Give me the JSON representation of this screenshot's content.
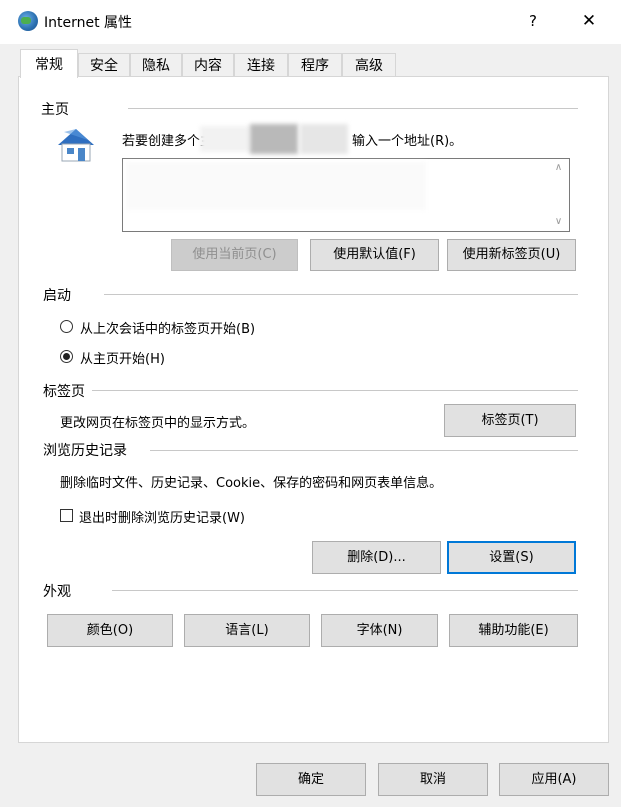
{
  "window": {
    "title": "Internet 属性",
    "help_glyph": "?",
    "close_glyph": "✕"
  },
  "tabs": [
    "常规",
    "安全",
    "隐私",
    "内容",
    "连接",
    "程序",
    "高级"
  ],
  "homepage": {
    "section_label": "主页",
    "instruction_start": "若要创建多个主",
    "instruction_end": "输入一个地址(R)。",
    "buttons": {
      "use_current": "使用当前页(C)",
      "use_default": "使用默认值(F)",
      "use_new_tab": "使用新标签页(U)"
    }
  },
  "startup": {
    "section_label": "启动",
    "options": [
      "从上次会话中的标签页开始(B)",
      "从主页开始(H)"
    ],
    "selected_index": 1
  },
  "tabs_section": {
    "section_label": "标签页",
    "description": "更改网页在标签页中的显示方式。",
    "button": "标签页(T)"
  },
  "history": {
    "section_label": "浏览历史记录",
    "description": "删除临时文件、历史记录、Cookie、保存的密码和网页表单信息。",
    "checkbox_label": "退出时删除浏览历史记录(W)",
    "checkbox_checked": false,
    "delete_button": "删除(D)...",
    "settings_button": "设置(S)"
  },
  "appearance": {
    "section_label": "外观",
    "buttons": [
      "颜色(O)",
      "语言(L)",
      "字体(N)",
      "辅助功能(E)"
    ]
  },
  "footer": {
    "ok": "确定",
    "cancel": "取消",
    "apply": "应用(A)"
  }
}
